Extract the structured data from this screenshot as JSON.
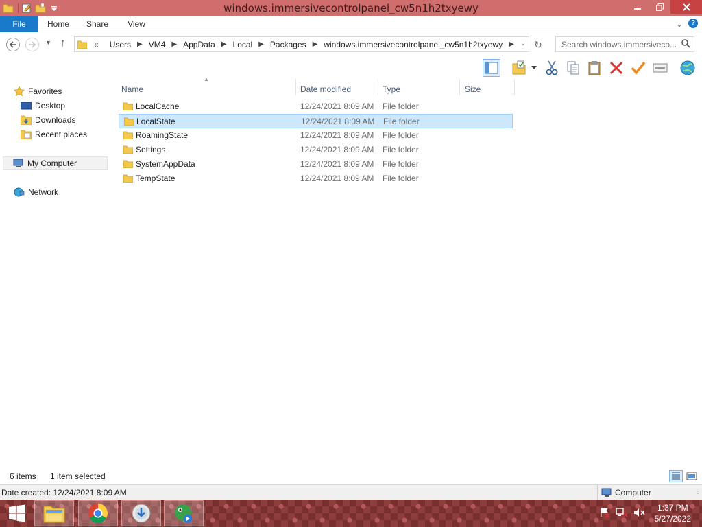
{
  "window": {
    "title": "windows.immersivecontrolpanel_cw5n1h2txyewy"
  },
  "ribbon": {
    "tabs": [
      {
        "label": "File"
      },
      {
        "label": "Home"
      },
      {
        "label": "Share"
      },
      {
        "label": "View"
      }
    ]
  },
  "address": {
    "overflow": "«",
    "crumbs": [
      "Users",
      "VM4",
      "AppData",
      "Local",
      "Packages",
      "windows.immersivecontrolpanel_cw5n1h2txyewy"
    ]
  },
  "search": {
    "placeholder": "Search windows.immersiveco..."
  },
  "toolbar": {
    "icons": [
      "preview-pane-icon",
      "select-icon",
      "cut-icon",
      "copy-icon",
      "paste-icon",
      "delete-icon",
      "check-icon",
      "rename-icon",
      "globe-icon"
    ]
  },
  "nav": {
    "favorites": "Favorites",
    "desktop": "Desktop",
    "downloads": "Downloads",
    "recent": "Recent places",
    "computer": "My Computer",
    "network": "Network"
  },
  "columns": {
    "name": "Name",
    "date": "Date modified",
    "type": "Type",
    "size": "Size"
  },
  "files": [
    {
      "name": "LocalCache",
      "date": "12/24/2021 8:09 AM",
      "type": "File folder"
    },
    {
      "name": "LocalState",
      "date": "12/24/2021 8:09 AM",
      "type": "File folder"
    },
    {
      "name": "RoamingState",
      "date": "12/24/2021 8:09 AM",
      "type": "File folder"
    },
    {
      "name": "Settings",
      "date": "12/24/2021 8:09 AM",
      "type": "File folder"
    },
    {
      "name": "SystemAppData",
      "date": "12/24/2021 8:09 AM",
      "type": "File folder"
    },
    {
      "name": "TempState",
      "date": "12/24/2021 8:09 AM",
      "type": "File folder"
    }
  ],
  "status": {
    "count": "6 items",
    "selected": "1 item selected",
    "date_created": "Date created: 12/24/2021 8:09 AM",
    "computer": "Computer"
  },
  "taskbar": {
    "apps": [
      "file-explorer-icon",
      "chrome-icon",
      "installer-icon",
      "media-app-icon"
    ],
    "time": "1:37 PM",
    "date": "5/27/2022"
  },
  "colors": {
    "titlebar": "#d06d6d",
    "file_tab": "#1979ca",
    "selection": "#cce8ff",
    "taskbar": "#8e3d3d"
  }
}
